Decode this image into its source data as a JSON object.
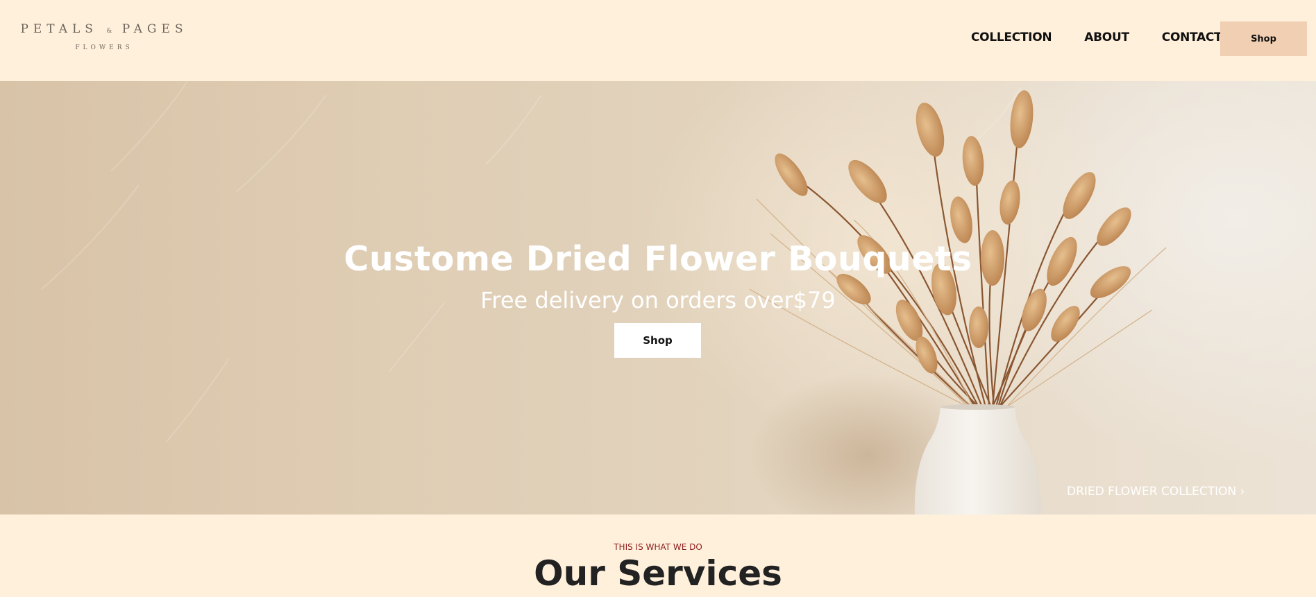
{
  "header": {
    "logo_main_left": "PETALS",
    "logo_amp": "&",
    "logo_main_right": "PAGES",
    "logo_sub": "FLOWERS",
    "nav": [
      "COLLECTION",
      "ABOUT",
      "CONTACT"
    ],
    "shop_label": "Shop"
  },
  "hero": {
    "title": "Custome Dried Flower Bouquets",
    "subtitle": "Free delivery on orders over$79",
    "shop_label": "Shop",
    "collection_link": "DRIED FLOWER COLLECTION",
    "collection_link_icon": "chevron-right-icon",
    "chevron": "›"
  },
  "services": {
    "eyebrow": "THIS IS WHAT WE DO",
    "title": "Our Services"
  },
  "colors": {
    "page_bg": "#fff0dc",
    "header_shop_bg": "#f0cfb3",
    "eyebrow": "#8c1d1d",
    "hero_text": "#ffffff"
  }
}
